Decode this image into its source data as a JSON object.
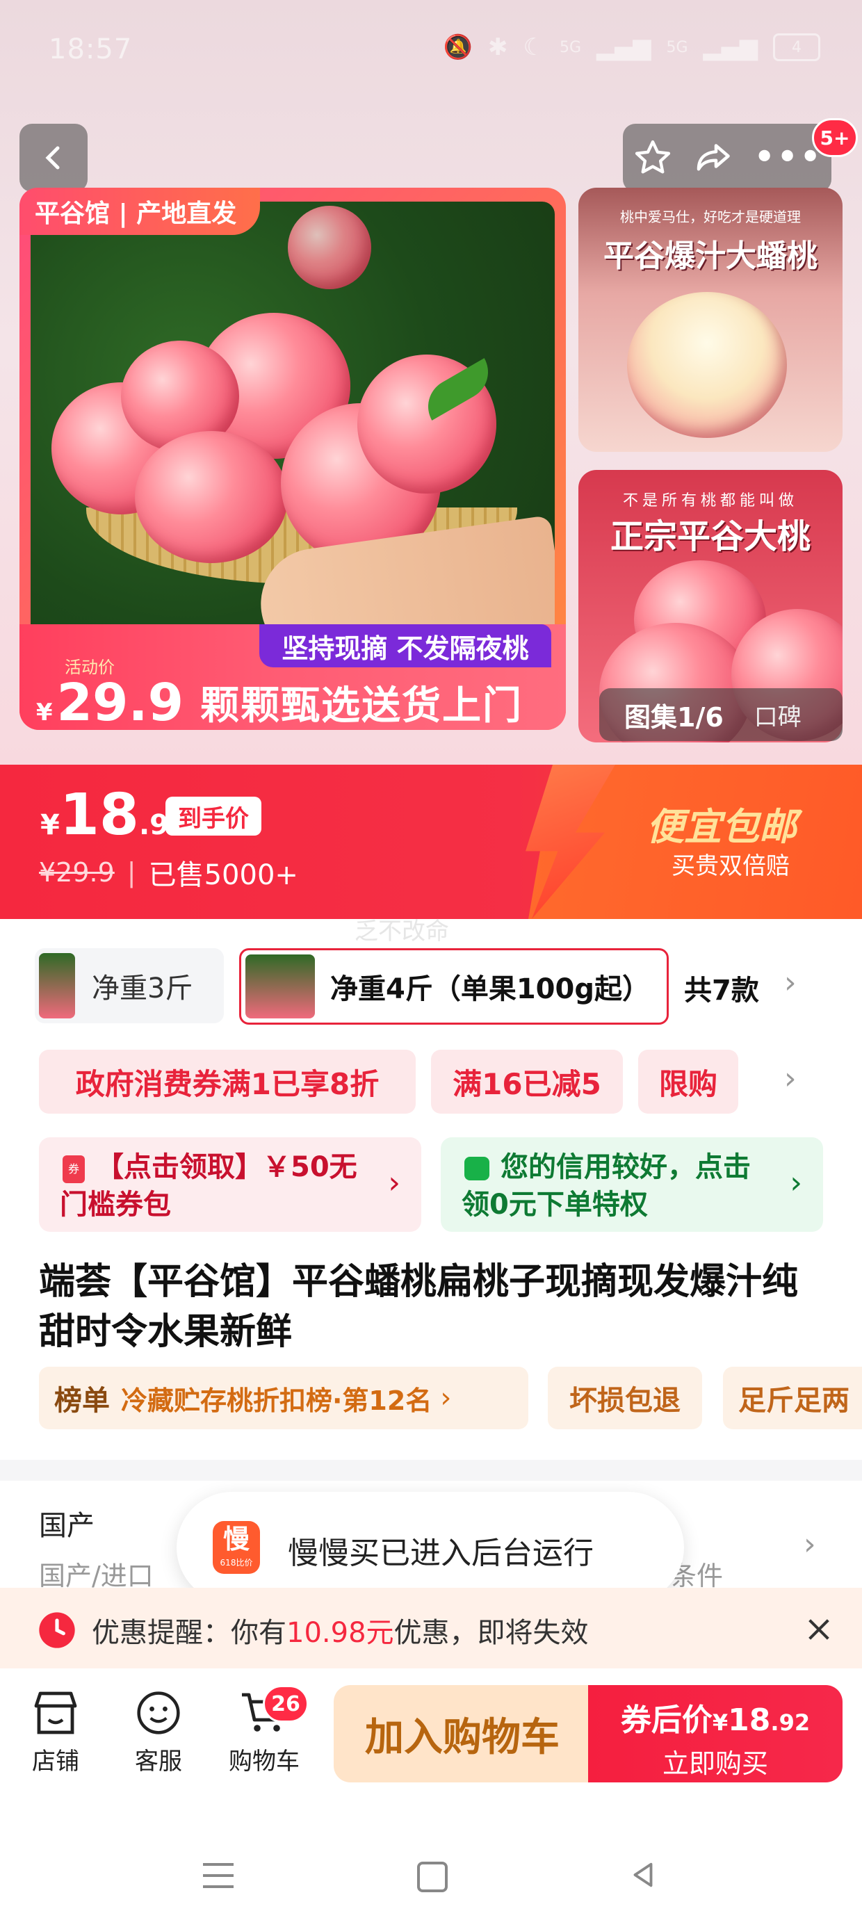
{
  "status_bar": {
    "time": "18:57",
    "network": [
      "5G",
      "5G"
    ],
    "battery": "4"
  },
  "header": {
    "back": "back",
    "cart_badge": "5+"
  },
  "gallery": {
    "main_tag": "平谷馆 | 产地直发",
    "promo_label": "活动价",
    "promo_currency": "¥",
    "promo_price": "29.9",
    "promo_slogan": "坚持现摘 不发隔夜桃",
    "promo_tagline": "颗颗甄选送货上门",
    "side1_small": "桃中爱马仕，好吃才是硬道理",
    "side1_big": "平谷爆汁大蟠桃",
    "side2_small": "不是所有桃都能叫做",
    "side2_big": "正宗平谷大桃",
    "counter": "图集1/6",
    "counter_extra": "口碑"
  },
  "price": {
    "currency": "¥",
    "int": "18",
    "dec": ".92",
    "label": "到手价",
    "original": "¥29.9",
    "sold": "已售5000+",
    "promo_title": "便宜包邮",
    "promo_sub": "买贵双倍赔",
    "watermark": "乏不改命"
  },
  "variants": {
    "items": [
      {
        "label": "净重3斤"
      },
      {
        "label": "净重4斤（单果100g起）"
      }
    ],
    "count": "共7款"
  },
  "coupons": {
    "c1": "政府消费券满1已享8折",
    "c2": "满16已减5",
    "c3": "限购"
  },
  "offers": {
    "left": "【点击领取】￥50无门槛券包",
    "right": "您的信用较好，点击领0元下单特权"
  },
  "product": {
    "title": "端荟【平谷馆】平谷蟠桃扁桃子现摘现发爆汁纯甜时令水果新鲜",
    "rank_label": "榜单",
    "rank_text": "冷藏贮存桃折扣榜·第12名",
    "tag1": "坏损包退",
    "tag2": "足斤足两"
  },
  "spec": {
    "label": "国产",
    "value_left": "国产/进口",
    "value_right": "条件"
  },
  "toast": {
    "app_icon": "慢",
    "app_sub": "618比价",
    "text": "慢慢买已进入后台运行"
  },
  "reminder": {
    "prefix": "优惠提醒：你有",
    "amount": "10.98元",
    "suffix": "优惠，即将失效"
  },
  "bottom": {
    "shop": "店铺",
    "service": "客服",
    "cart": "购物车",
    "cart_badge": "26",
    "add_cart": "加入购物车",
    "buy_prefix": "券后价",
    "buy_currency": "¥",
    "buy_int": "18",
    "buy_dec": ".92",
    "buy_now": "立即购买"
  }
}
